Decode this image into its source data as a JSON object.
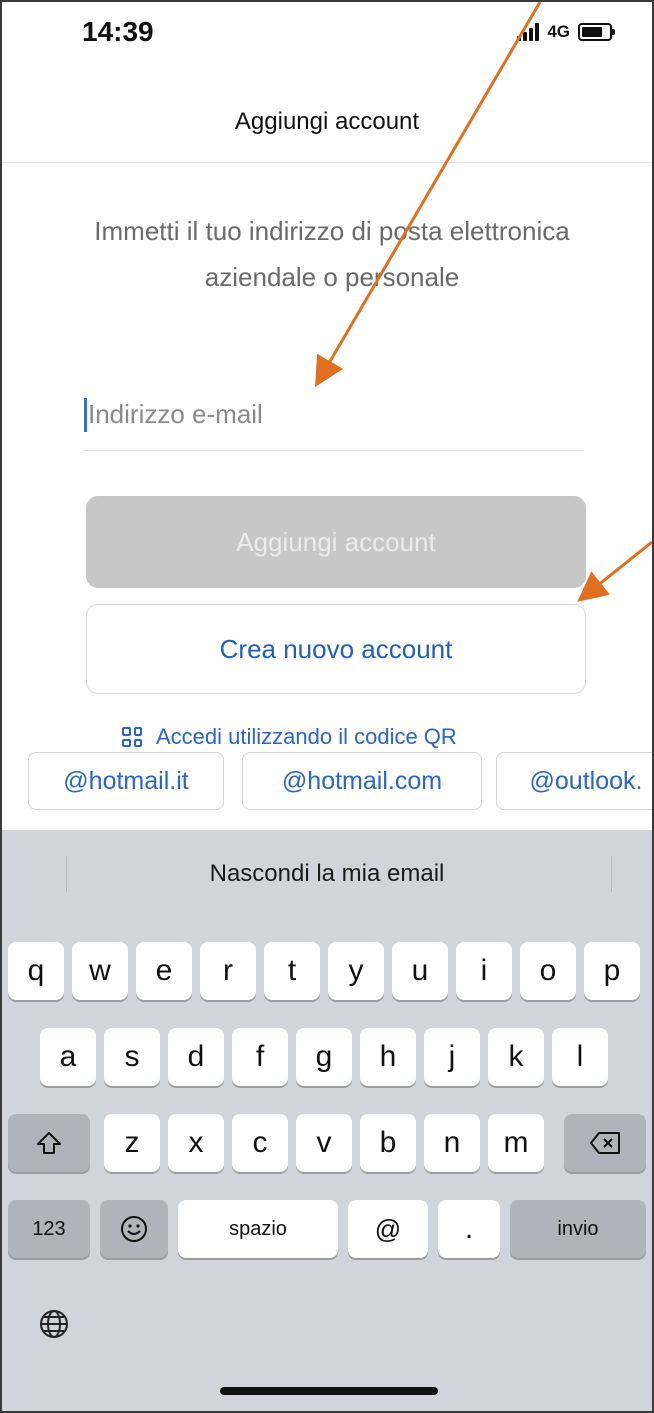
{
  "status_bar": {
    "time": "14:39",
    "network": "4G"
  },
  "header": {
    "title": "Aggiungi account"
  },
  "main": {
    "instructions": "Immetti il tuo indirizzo di posta elettronica aziendale o personale",
    "email_placeholder": "Indirizzo e-mail",
    "add_account_label": "Aggiungi account",
    "create_account_label": "Crea nuovo account",
    "qr_login_label": "Accedi utilizzando il codice QR"
  },
  "suggestions": [
    "@hotmail.it",
    "@hotmail.com",
    "@outlook."
  ],
  "keyboard": {
    "suggestion_bar": "Nascondi la mia email",
    "row1": [
      "q",
      "w",
      "e",
      "r",
      "t",
      "y",
      "u",
      "i",
      "o",
      "p"
    ],
    "row2": [
      "a",
      "s",
      "d",
      "f",
      "g",
      "h",
      "j",
      "k",
      "l"
    ],
    "row3": [
      "z",
      "x",
      "c",
      "v",
      "b",
      "n",
      "m"
    ],
    "numbers_key": "123",
    "space_key": "spazio",
    "at_key": "@",
    "dot_key": ".",
    "return_key": "invio"
  },
  "colors": {
    "accent": "#2a66c4",
    "annotation_arrow": "#e07020",
    "keyboard_bg": "#d1d4da"
  }
}
